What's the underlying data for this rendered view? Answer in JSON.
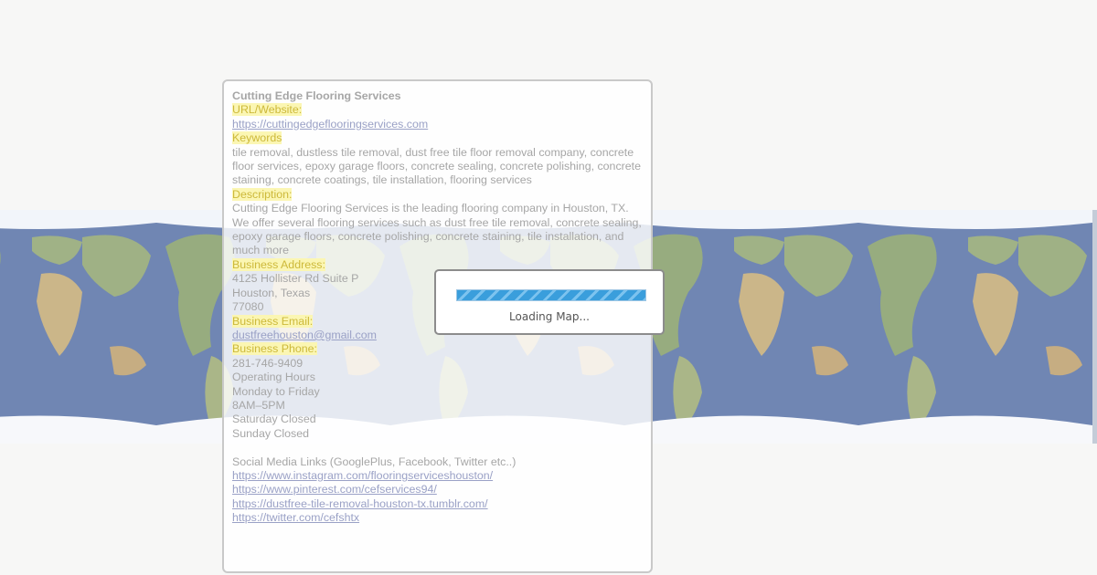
{
  "map": {
    "background_color": "#aeb9c9",
    "ocean_color": "#2c4a8a",
    "land_color": "#6a8a4a",
    "ice_color": "#ffffff"
  },
  "business": {
    "name": "Cutting Edge Flooring Services",
    "url_label": "URL/Website:",
    "url": "https://cuttingedgeflooringservices.com",
    "keywords_label": "Keywords",
    "keywords": "tile removal, dustless tile removal, dust free tile floor removal company, concrete floor services, epoxy garage floors, concrete sealing, concrete polishing, concrete staining, concrete coatings, tile installation, flooring services",
    "description_label": "Description:",
    "description": "Cutting Edge Flooring Services is the leading flooring company in Houston, TX. We offer several flooring services such as dust free tile removal, concrete sealing, epoxy garage floors, concrete polishing, concrete staining, tile installation, and much more",
    "address_label": "Business Address:",
    "address_line1": "4125 Hollister Rd Suite P",
    "address_line2": "Houston, Texas",
    "address_zip": "77080",
    "email_label": "Business Email:",
    "email": "dustfreehouston@gmail.com",
    "phone_label": "Business Phone:",
    "phone": "281-746-9409",
    "hours_title": "Operating Hours",
    "hours_days": "Monday to Friday",
    "hours_time": "8AM–5PM",
    "hours_saturday": "Saturday Closed",
    "hours_sunday": "Sunday Closed",
    "social_label": "Social Media Links (GooglePlus, Facebook, Twitter etc..)",
    "social_links": [
      "https://www.instagram.com/flooringserviceshouston/",
      "https://www.pinterest.com/cefservices94/",
      "https://dustfree-tile-removal-houston-tx.tumblr.com/",
      "https://twitter.com/cefshtx"
    ]
  },
  "loading": {
    "text": "Loading Map...",
    "progress_percent": 100,
    "bar_color": "#3a9edc"
  },
  "colors": {
    "highlight_bg": "#fbf6b3",
    "highlight_text": "#cdb93a",
    "link": "#9aa1c6",
    "text": "#a6a6a6"
  }
}
